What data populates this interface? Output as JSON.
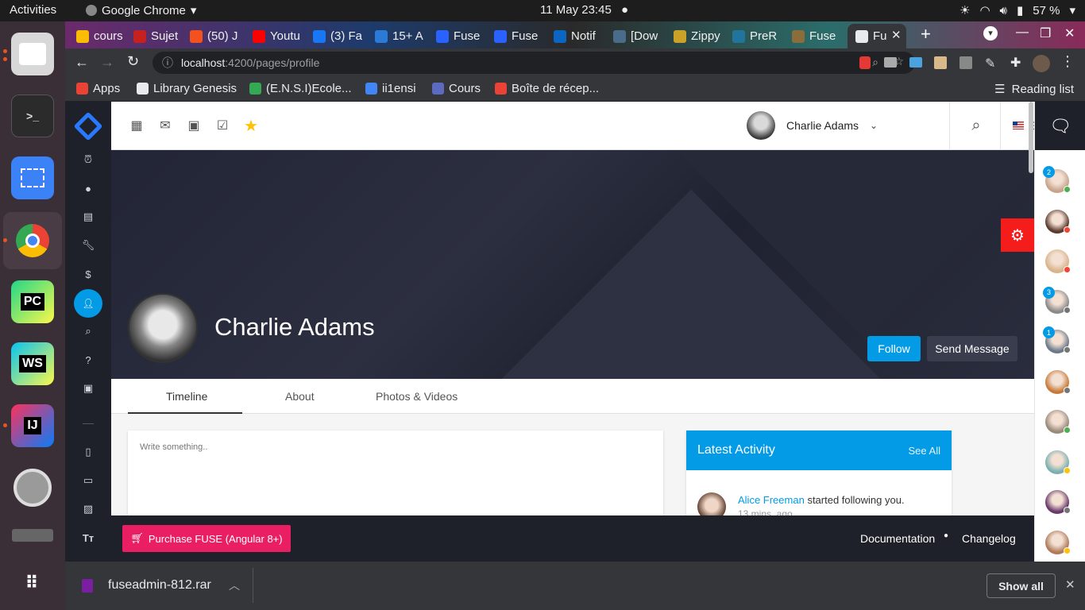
{
  "os": {
    "activities": "Activities",
    "app_name": "Google Chrome",
    "clock": "11 May  23:45",
    "battery": "57 %"
  },
  "chrome": {
    "tabs": [
      {
        "label": "cours",
        "color": "#fbbc04"
      },
      {
        "label": "Sujet",
        "color": "#c5221f"
      },
      {
        "label": "(50) J",
        "color": "#f4511e"
      },
      {
        "label": "Youtu",
        "color": "#ff0000"
      },
      {
        "label": "(3) Fa",
        "color": "#1877f2"
      },
      {
        "label": "15+ A",
        "color": "#2b7bd6"
      },
      {
        "label": "Fuse",
        "color": "#2962ff"
      },
      {
        "label": "Fuse",
        "color": "#2962ff"
      },
      {
        "label": "Notif",
        "color": "#0a66c2"
      },
      {
        "label": "[Dow",
        "color": "#4a6b8a"
      },
      {
        "label": "Zippy",
        "color": "#c9a227"
      },
      {
        "label": "PreR",
        "color": "#21759b"
      },
      {
        "label": "Fuse",
        "color": "#8a6d3b"
      },
      {
        "label": "Fu",
        "color": "#e8eaed"
      }
    ],
    "url_host": "localhost",
    "url_path": ":4200/pages/profile",
    "bookmarks": [
      {
        "label": "Apps",
        "color": "#ea4335"
      },
      {
        "label": "Library Genesis",
        "color": "#e8eaed"
      },
      {
        "label": "(E.N.S.I)Ecole...",
        "color": "#34a853"
      },
      {
        "label": "ii1ensi",
        "color": "#4285f4"
      },
      {
        "label": "Cours",
        "color": "#5c6bc0"
      },
      {
        "label": "Boîte de récep...",
        "color": "#ea4335"
      }
    ],
    "reading_list": "Reading list"
  },
  "app": {
    "user_name": "Charlie Adams",
    "language": "EN",
    "profile_name": "Charlie Adams",
    "follow_label": "Follow",
    "message_label": "Send Message",
    "tabs": [
      "Timeline",
      "About",
      "Photos & Videos"
    ],
    "post_placeholder": "Write something..",
    "activity_title": "Latest Activity",
    "activity_see_all": "See All",
    "activity_user": "Alice Freeman",
    "activity_text": "started following you.",
    "activity_time": "13 mins. ago",
    "purchase_label": "Purchase FUSE (Angular 8+)",
    "footer_docs": "Documentation",
    "footer_changelog": "Changelog",
    "accent": "#039be5",
    "pink": "#e91e63"
  },
  "quick_panel": {
    "contacts": [
      {
        "badge": "2",
        "status": "#4caf50",
        "color": "#c8a48c"
      },
      {
        "badge": "",
        "status": "#f44336",
        "color": "#5a3b2e"
      },
      {
        "badge": "",
        "status": "#f44336",
        "color": "#d9b48a"
      },
      {
        "badge": "3",
        "status": "#757575",
        "color": "#8a8a8a"
      },
      {
        "badge": "1",
        "status": "#757575",
        "color": "#6a7a8a"
      },
      {
        "badge": "",
        "status": "#757575",
        "color": "#c77a3a"
      },
      {
        "badge": "",
        "status": "#4caf50",
        "color": "#9a8a7a"
      },
      {
        "badge": "",
        "status": "#ffc107",
        "color": "#7ab0b0"
      },
      {
        "badge": "",
        "status": "#757575",
        "color": "#6a3a6a"
      },
      {
        "badge": "",
        "status": "#ffc107",
        "color": "#b07a5a"
      }
    ]
  },
  "downloads": {
    "file": "fuseadmin-812.rar",
    "show_all": "Show all"
  }
}
